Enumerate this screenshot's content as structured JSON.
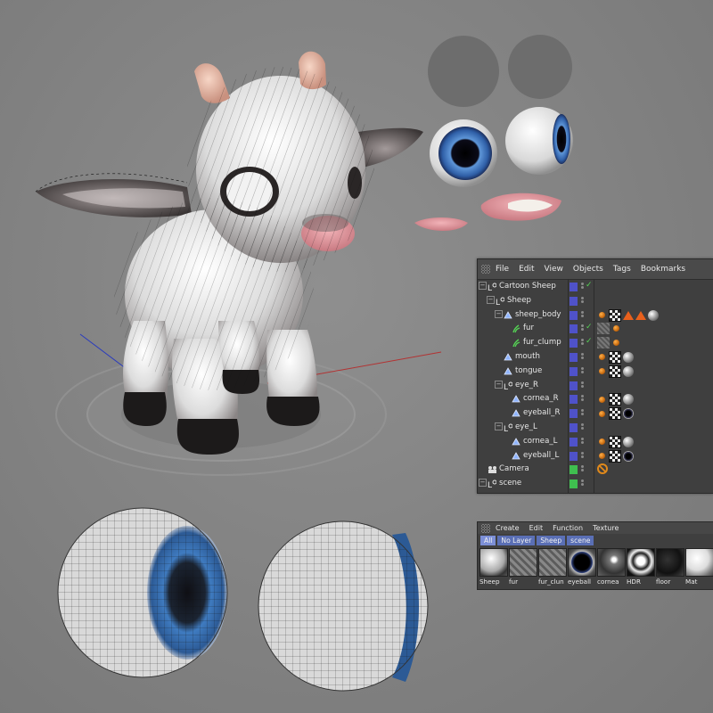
{
  "object_manager": {
    "menu": [
      "File",
      "Edit",
      "View",
      "Objects",
      "Tags",
      "Bookmarks"
    ],
    "tree": [
      {
        "label": "Cartoon Sheep",
        "depth": 0,
        "icon": "null-object-icon",
        "vis": "blue",
        "check": true
      },
      {
        "label": "Sheep",
        "depth": 1,
        "icon": "null-object-icon",
        "vis": "blue",
        "check": false
      },
      {
        "label": "sheep_body",
        "depth": 2,
        "icon": "polygon-object-icon",
        "vis": "blue",
        "check": false,
        "tags": [
          "phong",
          "checker",
          "tri",
          "tri",
          "ball"
        ]
      },
      {
        "label": "fur",
        "depth": 3,
        "icon": "fur-icon",
        "vis": "blue",
        "check": true,
        "tags": [
          "hatch",
          "phong"
        ]
      },
      {
        "label": "fur_clump",
        "depth": 3,
        "icon": "fur-icon",
        "vis": "blue",
        "check": true,
        "tags": [
          "hatch",
          "phong"
        ]
      },
      {
        "label": "mouth",
        "depth": 2,
        "icon": "polygon-object-icon",
        "vis": "blue",
        "check": false,
        "tags": [
          "phong",
          "checker",
          "ball"
        ]
      },
      {
        "label": "tongue",
        "depth": 2,
        "icon": "polygon-object-icon",
        "vis": "blue",
        "check": false,
        "tags": [
          "phong",
          "checker",
          "ball"
        ]
      },
      {
        "label": "eye_R",
        "depth": 2,
        "icon": "null-object-icon",
        "vis": "blue",
        "check": false
      },
      {
        "label": "cornea_R",
        "depth": 3,
        "icon": "polygon-object-icon",
        "vis": "blue",
        "check": false,
        "tags": [
          "phong",
          "checker",
          "ball"
        ]
      },
      {
        "label": "eyeball_R",
        "depth": 3,
        "icon": "polygon-object-icon",
        "vis": "blue",
        "check": false,
        "tags": [
          "phong",
          "checker",
          "eyeball"
        ]
      },
      {
        "label": "eye_L",
        "depth": 2,
        "icon": "null-object-icon",
        "vis": "blue",
        "check": false
      },
      {
        "label": "cornea_L",
        "depth": 3,
        "icon": "polygon-object-icon",
        "vis": "blue",
        "check": false,
        "tags": [
          "phong",
          "checker",
          "ball"
        ]
      },
      {
        "label": "eyeball_L",
        "depth": 3,
        "icon": "polygon-object-icon",
        "vis": "blue",
        "check": false,
        "tags": [
          "phong",
          "checker",
          "eyeball"
        ]
      },
      {
        "label": "Camera",
        "depth": 0,
        "icon": "camera-icon",
        "vis": "green",
        "check": false,
        "tags": [
          "forbid"
        ]
      },
      {
        "label": "scene",
        "depth": 0,
        "icon": "null-object-icon",
        "vis": "green",
        "check": false
      }
    ]
  },
  "material_manager": {
    "menu": [
      "Create",
      "Edit",
      "Function",
      "Texture"
    ],
    "filters": [
      "All",
      "No Layer",
      "Sheep",
      "scene"
    ],
    "materials": [
      {
        "label": "Sheep",
        "swatch": "fur-ball"
      },
      {
        "label": "fur",
        "swatch": "hatch"
      },
      {
        "label": "fur_clun",
        "swatch": "hatch"
      },
      {
        "label": "eyeball",
        "swatch": "eyeball"
      },
      {
        "label": "cornea",
        "swatch": "glass"
      },
      {
        "label": "HDR",
        "swatch": "hdr"
      },
      {
        "label": "floor",
        "swatch": "dark"
      },
      {
        "label": "Mat",
        "swatch": "white"
      }
    ]
  }
}
